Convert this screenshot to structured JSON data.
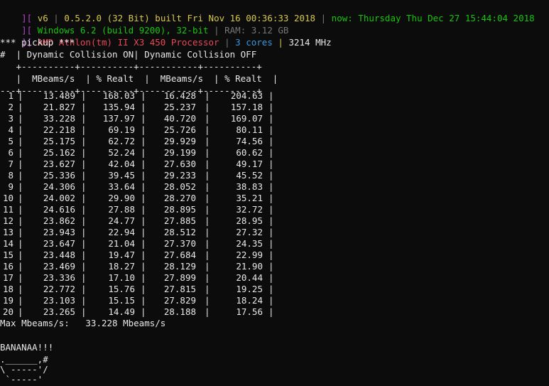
{
  "header": {
    "line1": {
      "prefix": "][",
      "version": "v6",
      "sep1": "|",
      "build": "0.5.2.0 (32 Bit) built Fri Nov 16 00:36:33 2018",
      "sep2": "|",
      "now": "now: Thursday Thu Dec 27 15:44:04 2018"
    },
    "line2": {
      "prefix": "][",
      "os": "Windows 6.2 (build 9200), 32-bit",
      "sep": "|",
      "ram": "RAM: 3.12 GB"
    },
    "line3": {
      "prefix": "][",
      "cpu": "AMD Athlon(tm) II X3 450 Processor",
      "sep1": "|",
      "cores": "3 cores",
      "sep2": "|",
      "mhz": "3214 MHz"
    }
  },
  "section_title": "*** pickup ***",
  "table": {
    "group_header": "#  | Dynamic Collision ON| Dynamic Collision OFF",
    "rule_top": "   +----------+----------+-----------+----------+",
    "col_header": "   |  MBeams/s  | % Realt  |  MBeams/s  | % Realt  |",
    "rule_mid": "---+----------+----------+-----------+----------+",
    "rows": [
      [
        "1",
        "13.489",
        "168.03",
        "16.428",
        "204.63"
      ],
      [
        "2",
        "21.827",
        "135.94",
        "25.237",
        "157.18"
      ],
      [
        "3",
        "33.228",
        "137.97",
        "40.720",
        "169.07"
      ],
      [
        "4",
        "22.218",
        "69.19",
        "25.726",
        "80.11"
      ],
      [
        "5",
        "25.175",
        "62.72",
        "29.929",
        "74.56"
      ],
      [
        "6",
        "25.162",
        "52.24",
        "29.199",
        "60.62"
      ],
      [
        "7",
        "23.627",
        "42.04",
        "27.630",
        "49.17"
      ],
      [
        "8",
        "25.336",
        "39.45",
        "29.233",
        "45.52"
      ],
      [
        "9",
        "24.306",
        "33.64",
        "28.052",
        "38.83"
      ],
      [
        "10",
        "24.002",
        "29.90",
        "28.270",
        "35.21"
      ],
      [
        "11",
        "24.616",
        "27.88",
        "28.895",
        "32.72"
      ],
      [
        "12",
        "23.862",
        "24.77",
        "27.885",
        "28.95"
      ],
      [
        "13",
        "23.943",
        "22.94",
        "28.512",
        "27.32"
      ],
      [
        "14",
        "23.647",
        "21.04",
        "27.370",
        "24.35"
      ],
      [
        "15",
        "23.448",
        "19.47",
        "27.684",
        "22.99"
      ],
      [
        "16",
        "23.469",
        "18.27",
        "28.129",
        "21.90"
      ],
      [
        "17",
        "23.336",
        "17.10",
        "27.899",
        "20.44"
      ],
      [
        "18",
        "22.772",
        "15.76",
        "27.815",
        "19.25"
      ],
      [
        "19",
        "23.103",
        "15.15",
        "27.829",
        "18.24"
      ],
      [
        "20",
        "23.265",
        "14.49",
        "28.188",
        "17.56"
      ]
    ]
  },
  "summary": "Max Mbeams/s:   33.228 Mbeams/s",
  "banner": {
    "line1": "BANANAA!!!",
    "line2": ".______,#",
    "line3": "\\ -----'/",
    "line4": " `-----'"
  }
}
